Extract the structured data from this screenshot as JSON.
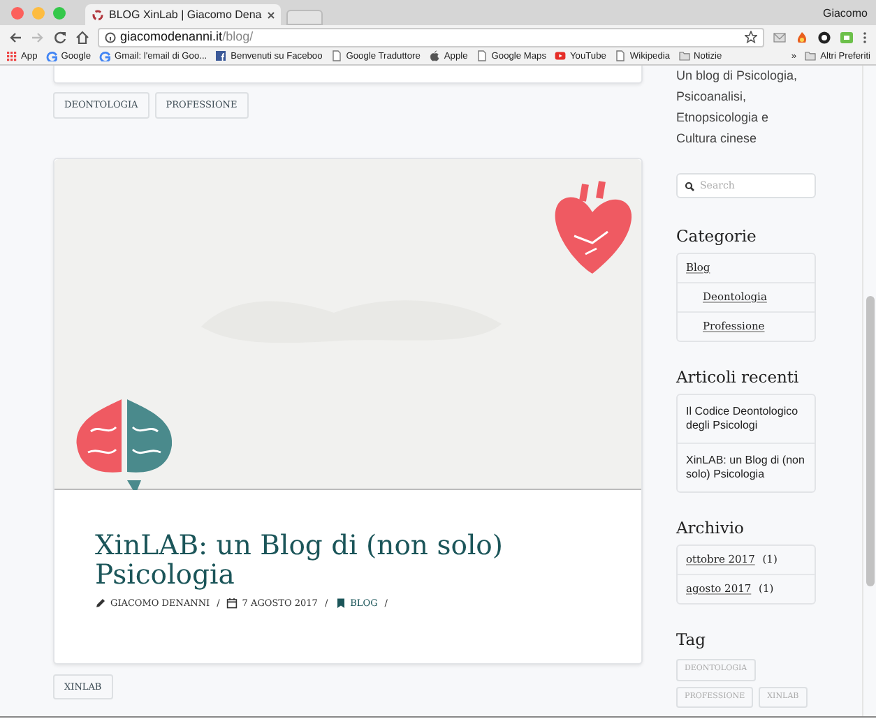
{
  "browser": {
    "tabs": [
      {
        "title": "BLOG XinLab | Giacomo Dena",
        "selected": true
      }
    ],
    "profile": "Giacomo",
    "url": {
      "host": "giacomodenanni.it",
      "path": "/blog/"
    },
    "bookmarks": [
      {
        "kind": "apps",
        "label": "App"
      },
      {
        "kind": "google",
        "label": "Google"
      },
      {
        "kind": "google",
        "label": "Gmail: l'email di Goo..."
      },
      {
        "kind": "facebook",
        "label": "Benvenuti su Faceboo"
      },
      {
        "kind": "page",
        "label": "Google Traduttore"
      },
      {
        "kind": "apple",
        "label": "Apple"
      },
      {
        "kind": "page",
        "label": "Google Maps"
      },
      {
        "kind": "youtube",
        "label": "YouTube"
      },
      {
        "kind": "page",
        "label": "Wikipedia"
      },
      {
        "kind": "folder",
        "label": "Notizie"
      }
    ],
    "overflow": "»",
    "other_bookmarks": "Altri Preferiti"
  },
  "previous_post": {
    "tags": [
      "DEONTOLOGIA",
      "PROFESSIONE"
    ]
  },
  "post": {
    "image": {
      "kind": "picture"
    },
    "title": "XinLAB: un Blog di (non solo) Psicologia",
    "meta": [
      {
        "kind": "author",
        "text": "GIACOMO DENANNI"
      },
      {
        "kind": "date",
        "text": "7 AGOSTO 2017"
      },
      {
        "kind": "category",
        "text": "BLOG"
      }
    ],
    "separator": "/",
    "tags": [
      "XINLAB"
    ]
  },
  "sidebar": {
    "description": "Un blog di Psicologia, Psicoanalisi, Etnopsicologia e Cultura cinese",
    "search": {
      "placeholder": "Search"
    },
    "categories": {
      "title": "Categorie",
      "items": [
        {
          "label": "Blog",
          "children": [
            {
              "label": "Deontologia"
            },
            {
              "label": "Professione"
            }
          ]
        }
      ]
    },
    "recent": {
      "title": "Articoli recenti",
      "items": [
        "Il Codice Deontologico degli Psicologi",
        "XinLAB: un Blog di (non solo) Psicologia"
      ]
    },
    "archive": {
      "title": "Archivio",
      "items": [
        {
          "label": "ottobre 2017",
          "count": "(1)"
        },
        {
          "label": "agosto 2017",
          "count": "(1)"
        }
      ]
    },
    "tags": {
      "title": "Tag",
      "items": [
        "DEONTOLOGIA",
        "PROFESSIONE",
        "XINLAB"
      ]
    }
  }
}
